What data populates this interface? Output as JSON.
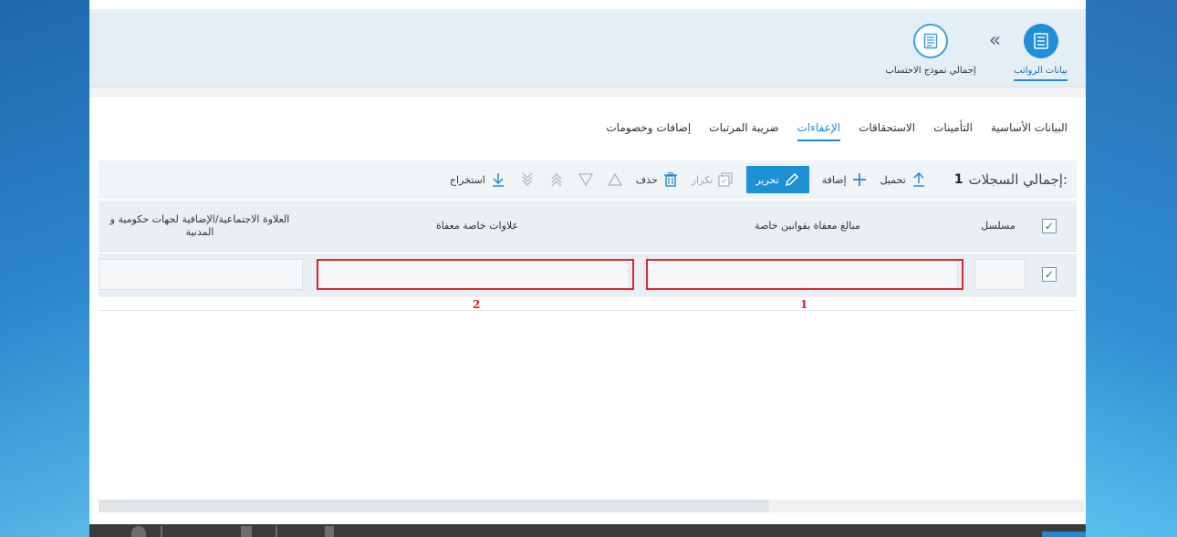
{
  "header": {
    "steps": [
      {
        "label": "بيانات الرواتب",
        "icon": "list-icon",
        "active": true
      },
      {
        "label": "إجمالي نموذج الاحتساب",
        "icon": "document-icon",
        "active": false
      }
    ],
    "separator": "«"
  },
  "tabs": [
    {
      "label": "البيانات الأساسية",
      "active": false
    },
    {
      "label": "التأمينات",
      "active": false
    },
    {
      "label": "الاستحقاقات",
      "active": false
    },
    {
      "label": "الإعفاءات",
      "active": true
    },
    {
      "label": "ضريبة المرتبات",
      "active": false
    },
    {
      "label": "إضافات وخصومات",
      "active": false
    }
  ],
  "toolbar": {
    "total_label": "إجمالي السجلات:",
    "total_count": "1",
    "upload": "تحميل",
    "add": "إضافة",
    "edit": "تحرير",
    "duplicate": "تكرار",
    "delete": "حذف",
    "export": "استخراج"
  },
  "grid": {
    "columns": [
      "مسلسل",
      "مبالغ معفاة بقوانين خاصة",
      "علاوات خاصة معفاة",
      "العلاوة الاجتماعية/الإضافية لجهات حكومية و المدنية"
    ],
    "rows": [
      {
        "checked": true,
        "serial": "",
        "col1": "",
        "col2": "",
        "col3": ""
      }
    ]
  },
  "annotations": {
    "marker1": "1",
    "marker2": "2",
    "highlight_color": "#e0242f"
  },
  "colors": {
    "accent": "#1f8fd6",
    "header_bg": "#e3eff5",
    "grid_bg": "#e9eff3"
  }
}
